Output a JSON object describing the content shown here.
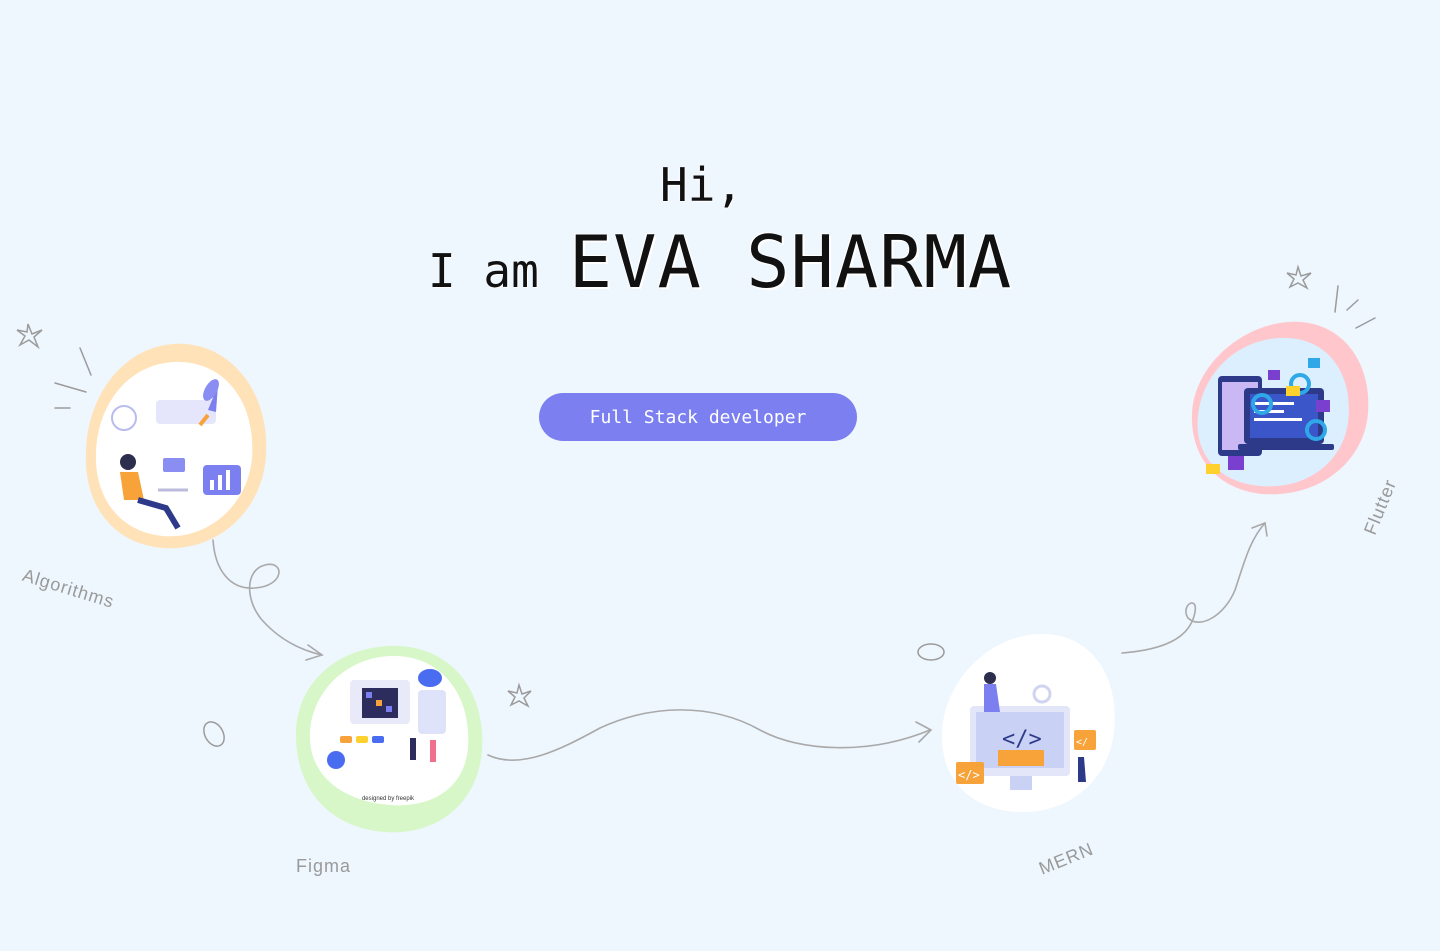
{
  "hero": {
    "greeting": "Hi,",
    "intro_prefix": "I am",
    "name": "EVA SHARMA",
    "role_button": "Full Stack developer"
  },
  "skills": [
    {
      "label": "Algorithms",
      "icon": "algorithms-illustration",
      "blob_color": "#ffe2b8"
    },
    {
      "label": "Figma",
      "icon": "figma-illustration",
      "blob_color": "#d7f7c8"
    },
    {
      "label": "MERN",
      "icon": "mern-illustration",
      "blob_color": "#ffffff"
    },
    {
      "label": "Flutter",
      "icon": "flutter-illustration",
      "blob_color": "#ffc7cc"
    }
  ],
  "figma_credit": "designed by freepik",
  "colors": {
    "background": "#eef6fe",
    "accent": "#7b7ff0",
    "doodle": "#9b9b9b"
  }
}
